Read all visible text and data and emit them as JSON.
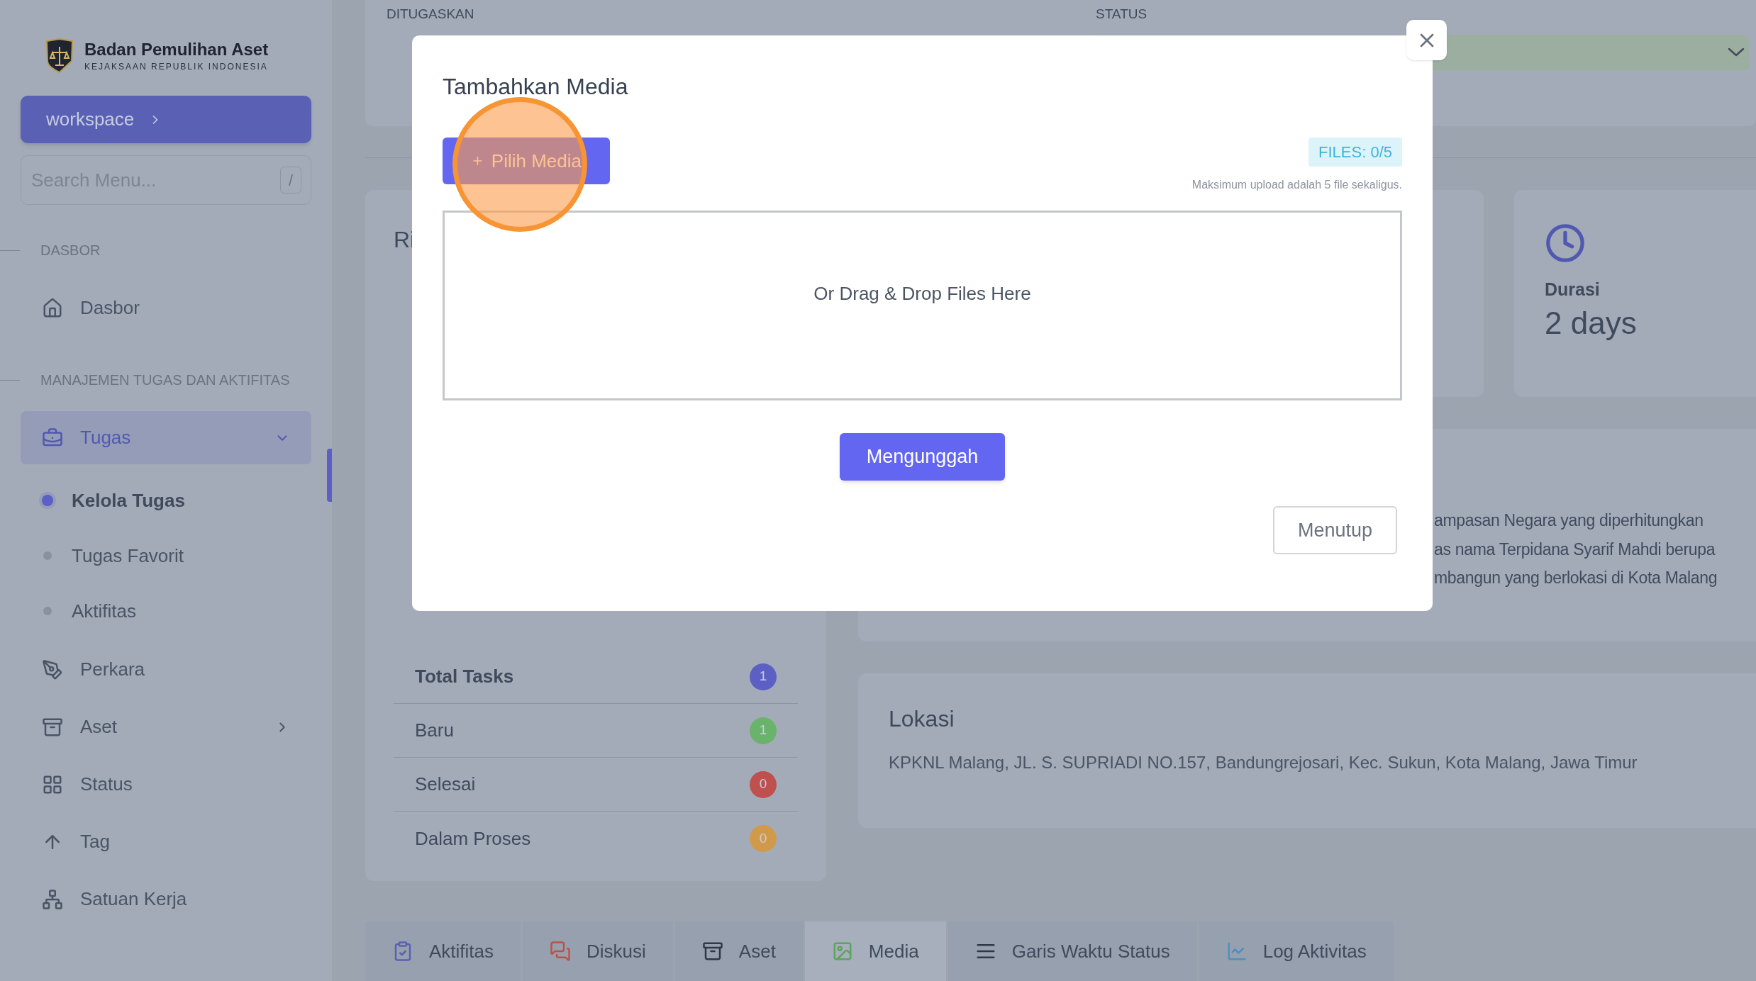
{
  "sidebar": {
    "brand": {
      "title": "Badan Pemulihan Aset",
      "subtitle": "KEJAKSAAN REPUBLIK INDONESIA"
    },
    "workspace_button": "workspace",
    "search": {
      "placeholder": "Search Menu...",
      "shortcut": "/"
    },
    "sections": [
      {
        "label": "DASBOR",
        "items": [
          {
            "label": "Dasbor",
            "kind": "link",
            "selected": false
          }
        ]
      },
      {
        "label": "MANAJEMEN TUGAS DAN AKTIFITAS",
        "items": [
          {
            "label": "Tugas",
            "kind": "group",
            "selected": true,
            "expanded": true,
            "children": [
              {
                "label": "Kelola Tugas",
                "selected": true
              },
              {
                "label": "Tugas Favorit",
                "selected": false
              },
              {
                "label": "Aktifitas",
                "selected": false
              }
            ]
          },
          {
            "label": "Perkara",
            "kind": "link",
            "selected": false
          },
          {
            "label": "Aset",
            "kind": "group",
            "selected": false,
            "expanded": false
          },
          {
            "label": "Status",
            "kind": "link",
            "selected": false
          },
          {
            "label": "Tag",
            "kind": "link",
            "selected": false
          },
          {
            "label": "Satuan Kerja",
            "kind": "link",
            "selected": false
          }
        ]
      }
    ]
  },
  "assignment_panel": {
    "labels": [
      "DITUGASKAN",
      "STATUS"
    ]
  },
  "summary_panel": {
    "title": "Ri",
    "rows": [
      {
        "label": "Total Tasks",
        "count": "1",
        "color": "#5c5fc4",
        "kind": "total"
      },
      {
        "label": "Baru",
        "count": "1",
        "color": "#6ab36a",
        "kind": "status"
      },
      {
        "label": "Selesai",
        "count": "0",
        "color": "#c0504d",
        "kind": "status"
      },
      {
        "label": "Dalam Proses",
        "count": "0",
        "color": "#d09a4a",
        "kind": "status"
      }
    ]
  },
  "duration_card": {
    "label": "Durasi",
    "value": "2 days"
  },
  "description_card": {
    "lines": [
      "ampasan Negara yang diperhitungkan",
      "as nama Terpidana Syarif Mahdi berupa",
      "mbangun yang berlokasi di Kota Malang"
    ]
  },
  "location_card": {
    "title": "Lokasi",
    "address": "KPKNL Malang, JL. S. SUPRIADI NO.157, Bandungrejosari, Kec. Sukun, Kota Malang, Jawa Timur"
  },
  "tabs": [
    {
      "label": "Aktifitas",
      "selected": false
    },
    {
      "label": "Diskusi",
      "selected": false
    },
    {
      "label": "Aset",
      "selected": false
    },
    {
      "label": "Media",
      "selected": true
    },
    {
      "label": "Garis Waktu Status",
      "selected": false
    },
    {
      "label": "Log Aktivitas",
      "selected": false
    }
  ],
  "modal": {
    "title": "Tambahkan Media",
    "choose_button": "Pilih Media",
    "files_badge": "FILES: 0/5",
    "limit_note": "Maksimum upload adalah 5 file sekaligus.",
    "dropzone_text": "Or Drag & Drop Files Here",
    "upload_button": "Mengunggah",
    "close_button": "Menutup"
  }
}
